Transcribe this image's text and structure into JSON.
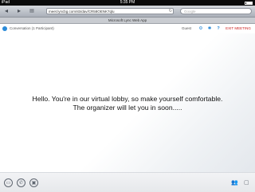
{
  "status": {
    "carrier": "iPad",
    "time": "5:35 PM"
  },
  "browser": {
    "back_icon": "back-arrow-icon",
    "forward_icon": "forward-arrow-icon",
    "bookmarks_icon": "bookmarks-icon",
    "url": "meet.lyncbg.com/sb/dav/CR58OENK7qlu",
    "search_placeholder": "Google",
    "tab_title": "Microsoft Lync Web App"
  },
  "header": {
    "conversation_title": "Conversation (1 Participant)",
    "guest_label": "Guest",
    "exit_label": "EXIT MEETING"
  },
  "lobby": {
    "line1": "Hello. You're in our virtual lobby, so make yourself comfortable.",
    "line2": "The organizer will let you in soon....."
  },
  "colors": {
    "accent": "#2a8ad8",
    "exit": "#cc2222"
  }
}
